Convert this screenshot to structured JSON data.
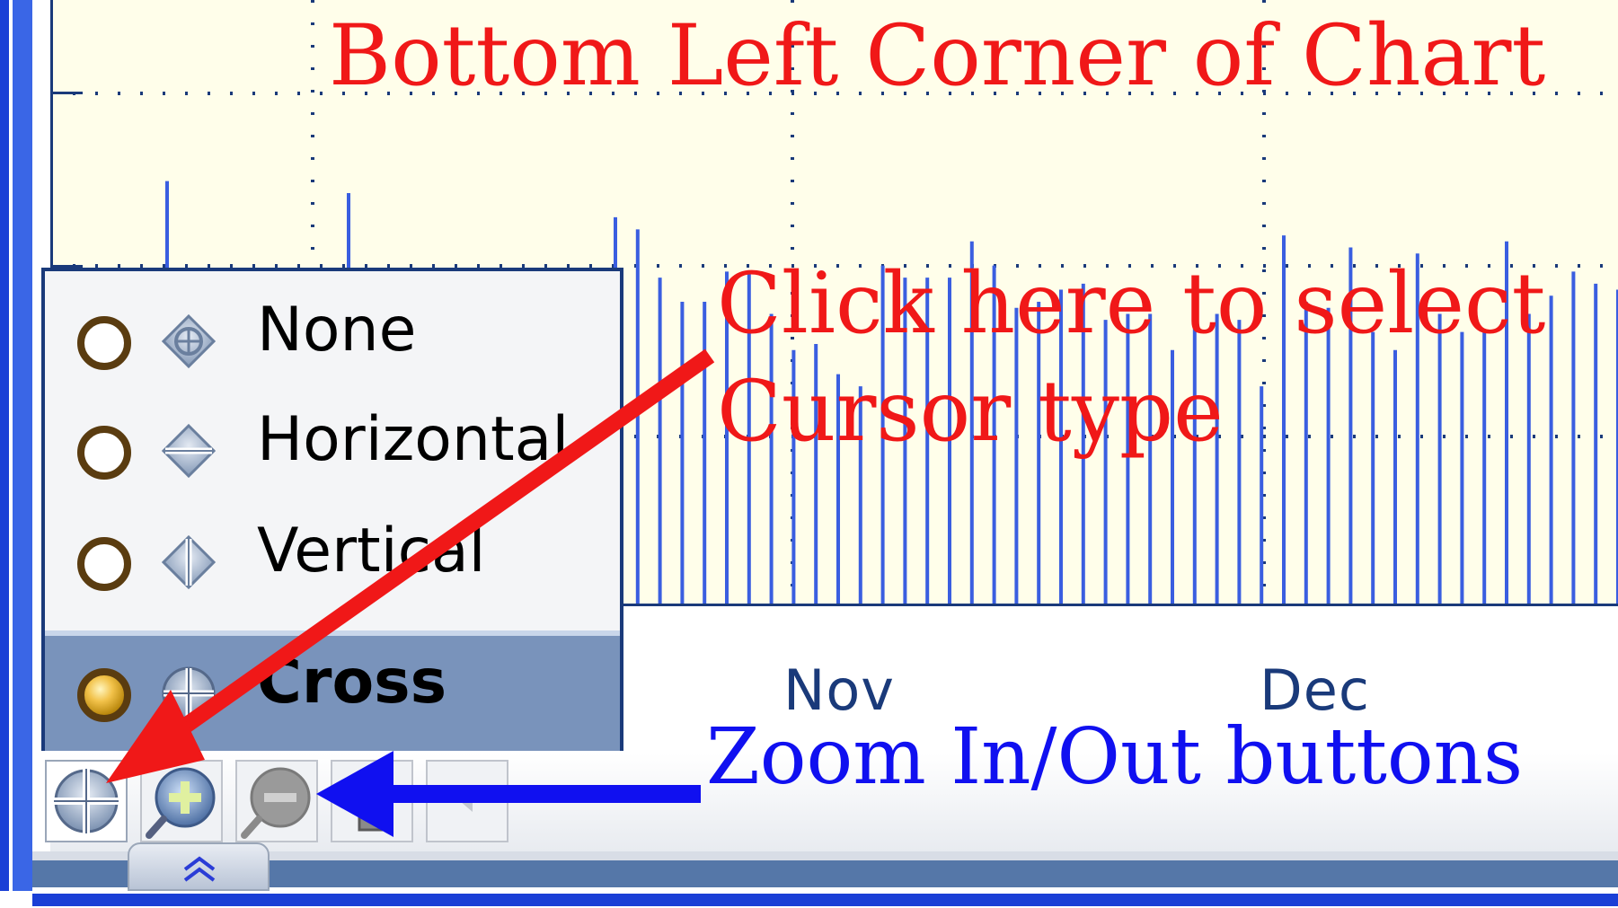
{
  "colors": {
    "chart_background": "#fffeea",
    "axis": "#1a3a7a",
    "bars": "#3a5ee0",
    "annotation_red": "#f01818",
    "annotation_blue": "#1010f0",
    "selected_item": "#7993bb"
  },
  "chart": {
    "month_labels": [
      "Nov",
      "Dec"
    ]
  },
  "chart_data": {
    "type": "bar",
    "x": [],
    "values": [
      64,
      62,
      54,
      50,
      50,
      55,
      55,
      48,
      42,
      43,
      38,
      36,
      56,
      54,
      54,
      54,
      60,
      56,
      49,
      50,
      52,
      53,
      47,
      48,
      48,
      42,
      53,
      48,
      47,
      36,
      61,
      50,
      49,
      59,
      45,
      42,
      58,
      48,
      45,
      45,
      60,
      48,
      51,
      55,
      53,
      52,
      53,
      48,
      56
    ],
    "xlabel": "",
    "ylabel": "",
    "grid": true,
    "categories_visible": [
      "Nov",
      "Dec"
    ]
  },
  "annotations": {
    "title": "Bottom Left Corner of Chart",
    "cursor_line1": "Click here to select",
    "cursor_line2": "Cursor type",
    "zoom": "Zoom In/Out buttons"
  },
  "cursor_menu": {
    "items": [
      {
        "label": "None",
        "icon": "cursor-none-icon",
        "checked": false
      },
      {
        "label": "Horizontal",
        "icon": "cursor-horizontal-icon",
        "checked": false
      },
      {
        "label": "Vertical",
        "icon": "cursor-vertical-icon",
        "checked": false
      },
      {
        "label": "Cross",
        "icon": "cursor-cross-icon",
        "checked": true
      }
    ]
  },
  "toolbar": {
    "buttons": [
      {
        "name": "cursor-type-button",
        "icon": "crosshair-icon"
      },
      {
        "name": "zoom-in-button",
        "icon": "zoom-in-icon"
      },
      {
        "name": "zoom-out-button",
        "icon": "zoom-out-icon"
      },
      {
        "name": "pan-button",
        "icon": "pan-icon"
      },
      {
        "name": "extra-button",
        "icon": "arrow-left-icon"
      }
    ]
  }
}
